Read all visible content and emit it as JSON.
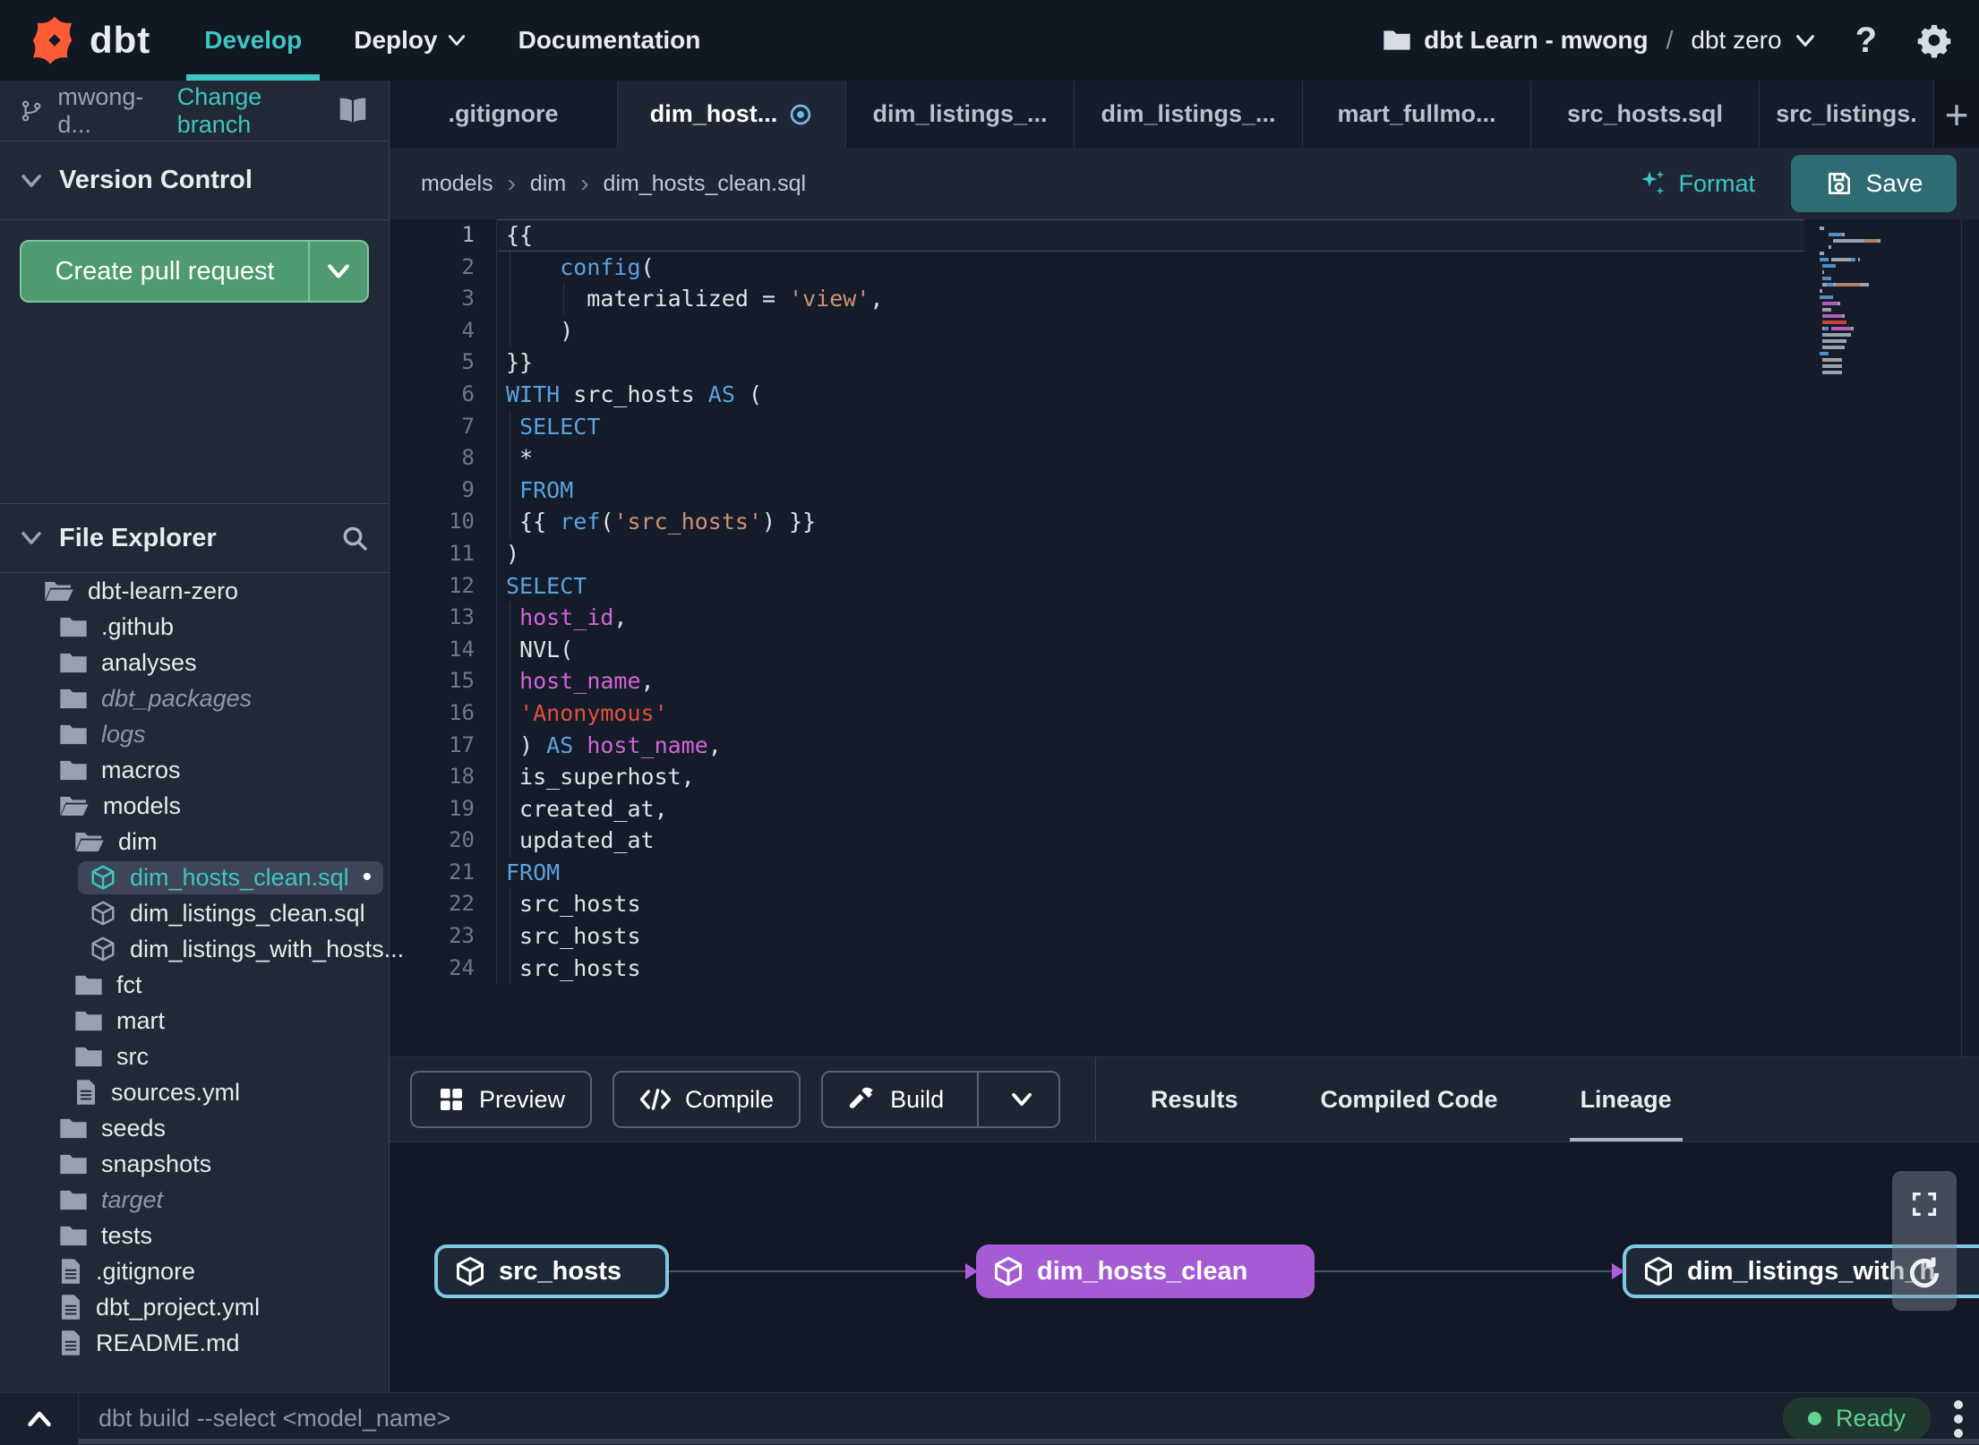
{
  "nav": {
    "brand": "dbt",
    "develop": "Develop",
    "deploy": "Deploy",
    "documentation": "Documentation",
    "project": "dbt Learn - mwong",
    "slash": "/",
    "environment": "dbt zero"
  },
  "sidebar": {
    "branch": "mwong-d...",
    "change_branch": "Change branch",
    "version_control": "Version Control",
    "create_pr": "Create pull request",
    "file_explorer": "File Explorer",
    "tree": [
      {
        "label": "dbt-learn-zero",
        "level": 0,
        "icon": "folder-open"
      },
      {
        "label": ".github",
        "level": 1,
        "icon": "folder"
      },
      {
        "label": "analyses",
        "level": 1,
        "icon": "folder"
      },
      {
        "label": "dbt_packages",
        "level": 1,
        "icon": "folder",
        "italic": true
      },
      {
        "label": "logs",
        "level": 1,
        "icon": "folder",
        "italic": true
      },
      {
        "label": "macros",
        "level": 1,
        "icon": "folder"
      },
      {
        "label": "models",
        "level": 1,
        "icon": "folder-open"
      },
      {
        "label": "dim",
        "level": 2,
        "icon": "folder-open"
      },
      {
        "label": "dim_hosts_clean.sql",
        "level": 3,
        "icon": "model",
        "selected": true,
        "modified": true
      },
      {
        "label": "dim_listings_clean.sql",
        "level": 3,
        "icon": "model"
      },
      {
        "label": "dim_listings_with_hosts...",
        "level": 3,
        "icon": "model"
      },
      {
        "label": "fct",
        "level": 2,
        "icon": "folder"
      },
      {
        "label": "mart",
        "level": 2,
        "icon": "folder"
      },
      {
        "label": "src",
        "level": 2,
        "icon": "folder"
      },
      {
        "label": "sources.yml",
        "level": 2,
        "icon": "file"
      },
      {
        "label": "seeds",
        "level": 1,
        "icon": "folder"
      },
      {
        "label": "snapshots",
        "level": 1,
        "icon": "folder"
      },
      {
        "label": "target",
        "level": 1,
        "icon": "folder",
        "italic": true
      },
      {
        "label": "tests",
        "level": 1,
        "icon": "folder"
      },
      {
        "label": ".gitignore",
        "level": 1,
        "icon": "file"
      },
      {
        "label": "dbt_project.yml",
        "level": 1,
        "icon": "file"
      },
      {
        "label": "README.md",
        "level": 1,
        "icon": "file"
      }
    ]
  },
  "tabs": [
    {
      "label": ".gitignore"
    },
    {
      "label": "dim_host...",
      "active": true,
      "modified": true
    },
    {
      "label": "dim_listings_..."
    },
    {
      "label": "dim_listings_..."
    },
    {
      "label": "mart_fullmo..."
    },
    {
      "label": "src_hosts.sql"
    },
    {
      "label": "src_listings.",
      "short": true
    }
  ],
  "breadcrumb": [
    "models",
    "dim",
    "dim_hosts_clean.sql"
  ],
  "editor": {
    "format_label": "Format",
    "save_label": "Save",
    "lines": [
      {
        "n": 1,
        "cur": true,
        "t": [
          [
            "{{",
            "p"
          ]
        ]
      },
      {
        "n": 2,
        "g": [
          4
        ],
        "t": [
          [
            "    ",
            "p"
          ],
          [
            "config",
            "k"
          ],
          [
            "(",
            "p"
          ]
        ]
      },
      {
        "n": 3,
        "g": [
          4,
          64
        ],
        "t": [
          [
            "      materialized = ",
            "p"
          ],
          [
            "'view'",
            "s"
          ],
          [
            ",",
            "p"
          ]
        ]
      },
      {
        "n": 4,
        "g": [
          4
        ],
        "t": [
          [
            "    )",
            "p"
          ]
        ]
      },
      {
        "n": 5,
        "t": [
          [
            "}}",
            "p"
          ]
        ]
      },
      {
        "n": 6,
        "t": [
          [
            "WITH",
            "k"
          ],
          [
            " src_hosts ",
            "p"
          ],
          [
            "AS",
            "k"
          ],
          [
            " (",
            "p"
          ]
        ]
      },
      {
        "n": 7,
        "g": [
          4
        ],
        "t": [
          [
            " ",
            "p"
          ],
          [
            "SELECT",
            "k"
          ]
        ]
      },
      {
        "n": 8,
        "g": [
          4
        ],
        "t": [
          [
            " *",
            "p"
          ]
        ]
      },
      {
        "n": 9,
        "g": [
          4
        ],
        "t": [
          [
            " ",
            "p"
          ],
          [
            "FROM",
            "k"
          ]
        ]
      },
      {
        "n": 10,
        "g": [
          4
        ],
        "t": [
          [
            " {{ ",
            "p"
          ],
          [
            "ref",
            "k"
          ],
          [
            "(",
            "p"
          ],
          [
            "'src_hosts'",
            "s"
          ],
          [
            ") }}",
            "p"
          ]
        ]
      },
      {
        "n": 11,
        "t": [
          [
            ")",
            "p"
          ]
        ]
      },
      {
        "n": 12,
        "t": [
          [
            "SELECT",
            "k"
          ]
        ]
      },
      {
        "n": 13,
        "g": [
          4
        ],
        "t": [
          [
            " ",
            "p"
          ],
          [
            "host_id",
            "f"
          ],
          [
            ",",
            "p"
          ]
        ]
      },
      {
        "n": 14,
        "g": [
          4
        ],
        "t": [
          [
            " NVL(",
            "p"
          ]
        ]
      },
      {
        "n": 15,
        "g": [
          4
        ],
        "t": [
          [
            " ",
            "p"
          ],
          [
            "host_name",
            "f"
          ],
          [
            ",",
            "p"
          ]
        ]
      },
      {
        "n": 16,
        "g": [
          4
        ],
        "t": [
          [
            " ",
            "p"
          ],
          [
            "'Anonymous'",
            "r"
          ]
        ]
      },
      {
        "n": 17,
        "g": [
          4
        ],
        "t": [
          [
            " ) ",
            "p"
          ],
          [
            "AS",
            "k"
          ],
          [
            " ",
            "p"
          ],
          [
            "host_name",
            "f"
          ],
          [
            ",",
            "p"
          ]
        ]
      },
      {
        "n": 18,
        "g": [
          4
        ],
        "t": [
          [
            " is_superhost,",
            "p"
          ]
        ]
      },
      {
        "n": 19,
        "g": [
          4
        ],
        "t": [
          [
            " created_at,",
            "p"
          ]
        ]
      },
      {
        "n": 20,
        "g": [
          4
        ],
        "t": [
          [
            " updated_at",
            "p"
          ]
        ]
      },
      {
        "n": 21,
        "t": [
          [
            "FROM",
            "k"
          ]
        ]
      },
      {
        "n": 22,
        "g": [
          4
        ],
        "t": [
          [
            " src_hosts",
            "p"
          ]
        ]
      },
      {
        "n": 23,
        "g": [
          4
        ],
        "t": [
          [
            " src_hosts",
            "p"
          ]
        ]
      },
      {
        "n": 24,
        "g": [
          4
        ],
        "t": [
          [
            " src_hosts",
            "p"
          ]
        ]
      }
    ]
  },
  "bottom": {
    "actions": [
      {
        "label": "Preview",
        "icon": "grid"
      },
      {
        "label": "Compile",
        "icon": "code"
      },
      {
        "label": "Build",
        "icon": "hammer",
        "split": true
      }
    ],
    "tabs": [
      {
        "label": "Results"
      },
      {
        "label": "Compiled Code"
      },
      {
        "label": "Lineage",
        "active": true
      }
    ]
  },
  "lineage": {
    "nodes": [
      {
        "label": "src_hosts",
        "kind": "source"
      },
      {
        "label": "dim_hosts_clean",
        "kind": "model"
      },
      {
        "label": "dim_listings_with_h",
        "kind": "source"
      }
    ]
  },
  "statusbar": {
    "command": "dbt build --select <model_name>",
    "status": "Ready"
  },
  "colors": {
    "accent_teal": "#3ec6c3",
    "brand_orange": "#ff5c35",
    "pr_green": "#4d9b6e",
    "save_teal": "#2f6b72",
    "node_purple": "#a55bd4",
    "node_cyan": "#7ec8e3",
    "ready_green": "#5fd392",
    "modified_blue": "#6cb8e8",
    "keyword_blue": "#5ca2e0",
    "string_salmon": "#ce9178",
    "string_red": "#e0513d",
    "field_magenta": "#d465d8"
  }
}
